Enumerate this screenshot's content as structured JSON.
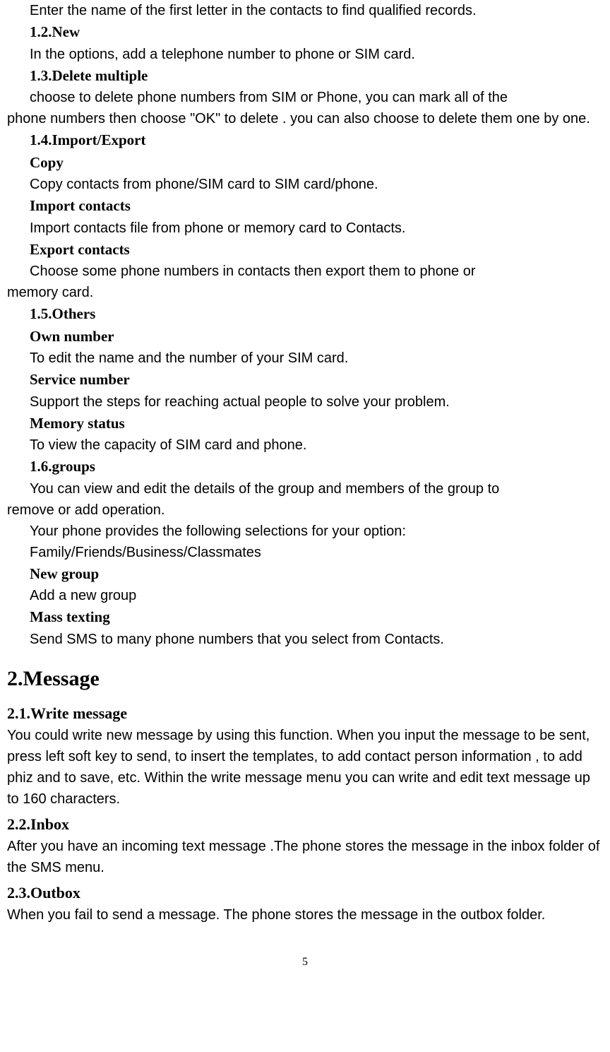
{
  "p1": "Enter the name of the first letter in the contacts to find qualified records.",
  "h1_2": "1.2.New",
  "p1_2": "In the options, add a telephone number to phone or SIM card.",
  "h1_3": "1.3.Delete multiple",
  "p1_3a": "choose to delete phone numbers from SIM or Phone, you can mark all of the",
  "p1_3b": "phone numbers then choose \"OK\" to delete . you can also choose to delete them one by one.",
  "h1_4": "1.4.Import/Export",
  "h_copy": "Copy",
  "p_copy": "Copy contacts from phone/SIM card to SIM card/phone.",
  "h_import": "Import contacts",
  "p_import": "Import contacts file from phone or memory card to Contacts.",
  "h_export": "Export contacts",
  "p_export_a": "Choose some phone numbers in contacts then export them to phone or",
  "p_export_b": "memory card.",
  "h1_5": "1.5.Others",
  "h_own": "Own number",
  "p_own": "To edit the name and the number of your SIM card.",
  "h_service": "Service number",
  "p_service": "Support the steps for reaching actual people to solve your problem.",
  "h_memory": "Memory status",
  "p_memory": "To view the capacity of SIM card and phone.",
  "h1_6": "1.6.groups",
  "p1_6a": "You can view and edit the details of the group and members of the group to",
  "p1_6b": "remove or add operation.",
  "p1_6c": "Your phone provides the following selections for your option:",
  "p1_6d": "Family/Friends/Business/Classmates",
  "h_newgroup": "New group",
  "p_newgroup": "Add a new group",
  "h_mass": "Mass texting",
  "p_mass": "Send SMS to many phone numbers that you select from Contacts.",
  "h2": "2.Message",
  "h2_1": "2.1.Write message",
  "p2_1": "You could write new message by using this function. When you input the message to be sent, press left soft key to send, to insert the templates, to add contact person information , to add phiz and to save, etc. Within the write message menu you can write and edit text message up to 160 characters.",
  "h2_2": "2.2.Inbox",
  "p2_2": "After you have an incoming text message .The phone stores the message in the inbox folder of the SMS menu.",
  "h2_3": "2.3.Outbox",
  "p2_3": "When you fail to send a message. The phone stores the message in the outbox folder.",
  "page_num": "5"
}
